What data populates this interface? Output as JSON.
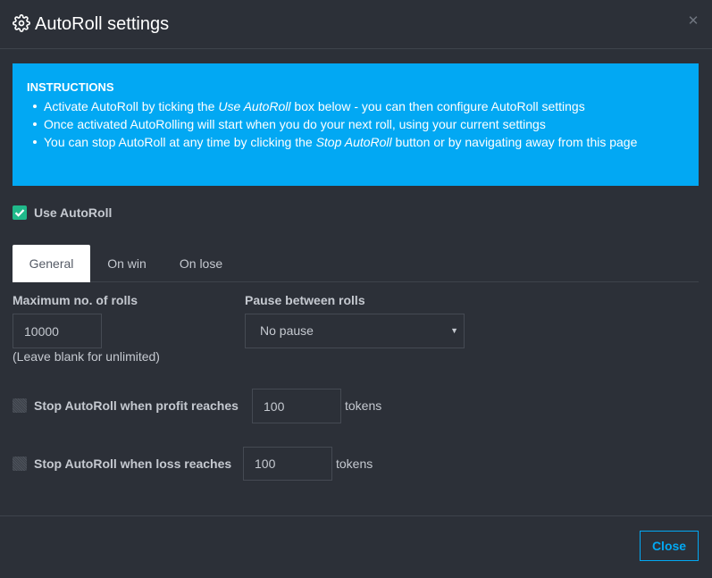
{
  "dialog": {
    "title": "AutoRoll settings",
    "title_icon": "gear-icon",
    "close_icon": "close-icon"
  },
  "instructions": {
    "heading": "INSTRUCTIONS",
    "items": [
      {
        "pre": "Activate AutoRoll by ticking the ",
        "em": "Use AutoRoll",
        "post": " box below - you can then configure AutoRoll settings"
      },
      {
        "pre": "Once activated AutoRolling will start when you do your next roll, using your current settings",
        "em": "",
        "post": ""
      },
      {
        "pre": "You can stop AutoRoll at any time by clicking the ",
        "em": "Stop AutoRoll",
        "post": " button or by navigating away from this page"
      }
    ]
  },
  "use_autoroll": {
    "label": "Use AutoRoll",
    "checked": true
  },
  "tabs": [
    {
      "label": "General",
      "active": true
    },
    {
      "label": "On win",
      "active": false
    },
    {
      "label": "On lose",
      "active": false
    }
  ],
  "general": {
    "max_rolls_label": "Maximum no. of rolls",
    "max_rolls_value": "10000",
    "max_rolls_hint": "(Leave blank for unlimited)",
    "pause_label": "Pause between rolls",
    "pause_value": "No pause",
    "profit_label": "Stop AutoRoll when profit reaches",
    "profit_value": "100",
    "profit_checked": false,
    "loss_label": "Stop AutoRoll when loss reaches",
    "loss_value": "100",
    "loss_checked": false,
    "unit": "tokens"
  },
  "footer": {
    "close_label": "Close"
  },
  "colors": {
    "background": "#2c3038",
    "instructions_bg": "#02a8f3",
    "checkbox_checked": "#20b98a",
    "accent": "#02a8f3"
  }
}
